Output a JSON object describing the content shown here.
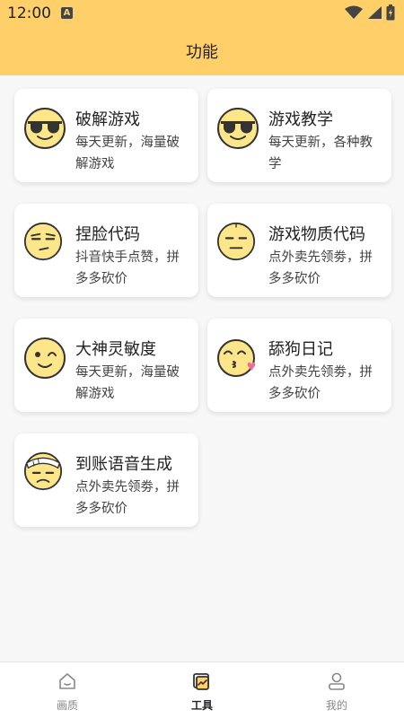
{
  "status": {
    "time": "12:00",
    "badge": "A"
  },
  "header": {
    "title": "功能"
  },
  "cards": [
    {
      "title": "破解游戏",
      "desc": "每天更新，海量破解游戏",
      "icon": "sunglasses-face-icon"
    },
    {
      "title": "游戏教学",
      "desc": "每天更新，各种教学",
      "icon": "sunglasses-face-icon"
    },
    {
      "title": "捏脸代码",
      "desc": "抖音快手点赞，拼多多砍价",
      "icon": "unamused-face-icon"
    },
    {
      "title": "游戏物质代码",
      "desc": "点外卖先领劵，拼多多砍价",
      "icon": "expressionless-face-icon"
    },
    {
      "title": "大神灵敏度",
      "desc": "每天更新，海量破解游戏",
      "icon": "winking-face-icon"
    },
    {
      "title": "舔狗日记",
      "desc": "点外卖先领劵，拼多多砍价",
      "icon": "kissing-face-icon"
    },
    {
      "title": "到账语音生成",
      "desc": "点外卖先领劵，拼多多砍价",
      "icon": "bandaged-face-icon"
    }
  ],
  "nav": [
    {
      "label": "画质",
      "icon": "home-icon",
      "active": false
    },
    {
      "label": "工具",
      "icon": "tools-icon",
      "active": true
    },
    {
      "label": "我的",
      "icon": "user-icon",
      "active": false
    }
  ],
  "colors": {
    "accent": "#ffcf6a",
    "face": "#fde58a",
    "face_outline": "#333333"
  }
}
